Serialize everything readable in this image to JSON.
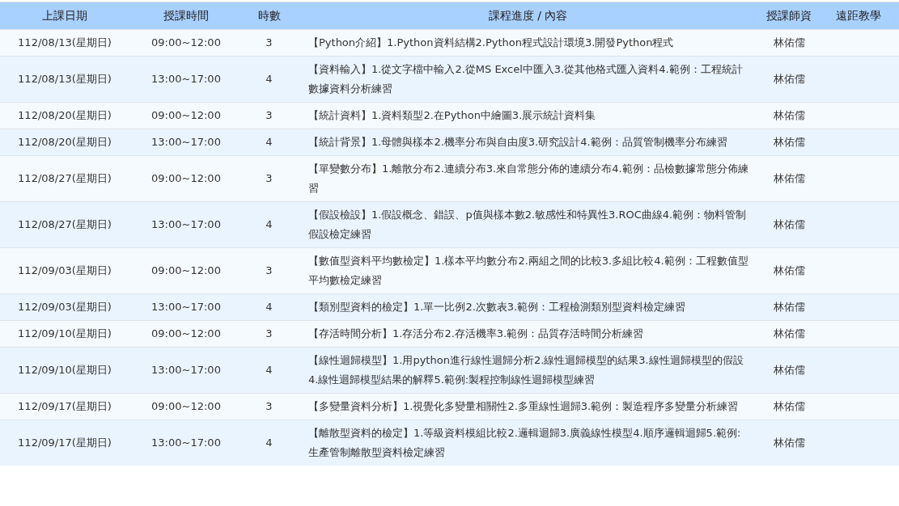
{
  "table": {
    "columns": [
      "上課日期",
      "授課時間",
      "時數",
      "課程進度 / 內容",
      "授課師資",
      "遠距教學"
    ],
    "rows": [
      {
        "date": "112/08/13(星期日)",
        "time": "09:00~12:00",
        "hours": "3",
        "content": "【Python介紹】1.Python資料結構2.Python程式設計環境3.開發Python程式",
        "teacher": "林佑儒"
      },
      {
        "date": "112/08/13(星期日)",
        "time": "13:00~17:00",
        "hours": "4",
        "content": "【資料輸入】1.從文字檔中輸入2.從MS Excel中匯入3.從其他格式匯入資料4.範例：工程統計數據資料分析練習",
        "teacher": "林佑儒"
      },
      {
        "date": "112/08/20(星期日)",
        "time": "09:00~12:00",
        "hours": "3",
        "content": "【統計資料】1.資料類型2.在Python中繪圖3.展示統計資料集",
        "teacher": "林佑儒"
      },
      {
        "date": "112/08/20(星期日)",
        "time": "13:00~17:00",
        "hours": "4",
        "content": "【統計背景】1.母體與樣本2.機率分布與自由度3.研究設計4.範例：品質管制機率分布練習",
        "teacher": "林佑儒"
      },
      {
        "date": "112/08/27(星期日)",
        "time": "09:00~12:00",
        "hours": "3",
        "content": "【單變數分布】1.離散分布2.連續分布3.來自常態分佈的連續分布4.範例：品檢數據常態分佈練習",
        "teacher": "林佑儒"
      },
      {
        "date": "112/08/27(星期日)",
        "time": "13:00~17:00",
        "hours": "4",
        "content": "【假設檢設】1.假設概念、錯誤、p值與樣本數2.敏感性和特異性3.ROC曲線4.範例：物料管制假設檢定練習",
        "teacher": "林佑儒"
      },
      {
        "date": "112/09/03(星期日)",
        "time": "09:00~12:00",
        "hours": "3",
        "content": "【數值型資料平均數檢定】1.樣本平均數分布2.兩組之間的比較3.多組比較4.範例：工程數值型平均數檢定練習",
        "teacher": "林佑儒"
      },
      {
        "date": "112/09/03(星期日)",
        "time": "13:00~17:00",
        "hours": "4",
        "content": "【類別型資料的檢定】1.單一比例2.次數表3.範例：工程檢測類別型資料檢定練習",
        "teacher": "林佑儒"
      },
      {
        "date": "112/09/10(星期日)",
        "time": "09:00~12:00",
        "hours": "3",
        "content": "【存活時間分析】1.存活分布2.存活機率3.範例：品質存活時間分析練習",
        "teacher": "林佑儒"
      },
      {
        "date": "112/09/10(星期日)",
        "time": "13:00~17:00",
        "hours": "4",
        "content": "【線性迴歸模型】1.用python進行線性迴歸分析2.線性迴歸模型的結果3.線性迴歸模型的假設4.線性迴歸模型結果的解釋5.範例:製程控制線性迴歸模型練習",
        "teacher": "林佑儒"
      },
      {
        "date": "112/09/17(星期日)",
        "time": "09:00~12:00",
        "hours": "3",
        "content": "【多變量資料分析】1.視覺化多變量相關性2.多重線性迴歸3.範例：製造程序多變量分析練習",
        "teacher": "林佑儒"
      },
      {
        "date": "112/09/17(星期日)",
        "time": "13:00~17:00",
        "hours": "4",
        "content": "【離散型資料的檢定】1.等級資料模組比較2.邏輯迴歸3.廣義線性模型4.順序邏輯迴歸5.範例:生產管制離散型資料檢定練習",
        "teacher": "林佑儒"
      }
    ]
  }
}
